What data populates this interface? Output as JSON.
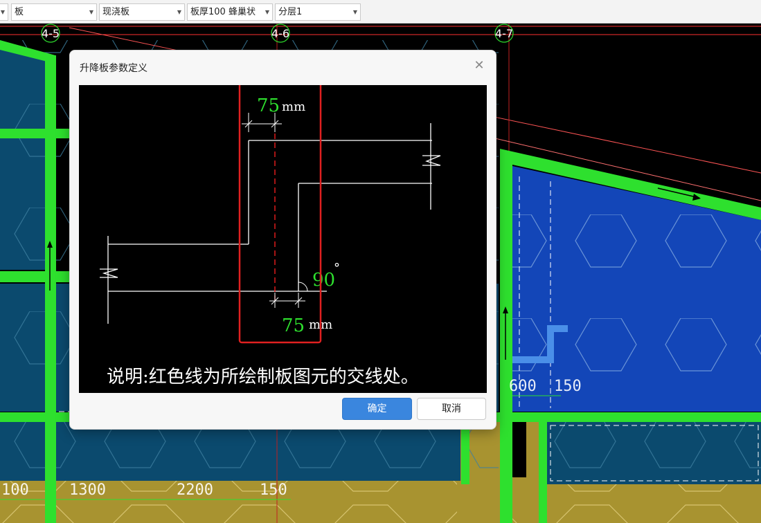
{
  "toolbar": {
    "dropdowns": [
      {
        "value": ""
      },
      {
        "value": "板"
      },
      {
        "value": "现浇板"
      },
      {
        "value": "板厚100 蜂巢状"
      },
      {
        "value": "分层1"
      }
    ]
  },
  "canvas": {
    "axis_labels": [
      "4-5",
      "4-6",
      "4-7"
    ],
    "dims_bottom": [
      "100",
      "1300",
      "2200",
      "150"
    ],
    "dims_right": [
      "600",
      "150"
    ]
  },
  "dialog": {
    "title": "升降板参数定义",
    "top_offset_value": "75",
    "top_offset_unit": "mm",
    "bottom_offset_value": "75",
    "bottom_offset_unit": "mm",
    "angle_value": "90",
    "angle_unit": "°",
    "note": "说明:红色线为所绘制板图元的交线处。",
    "ok_label": "确定",
    "cancel_label": "取消"
  },
  "colors": {
    "slab_fill": "#0b4a6e",
    "slab_blue": "#1346b8",
    "beam_green": "#2ee02e",
    "yellow_fill": "#a89330",
    "highlight_red": "#e02020",
    "accent_blue": "#3a86de"
  }
}
